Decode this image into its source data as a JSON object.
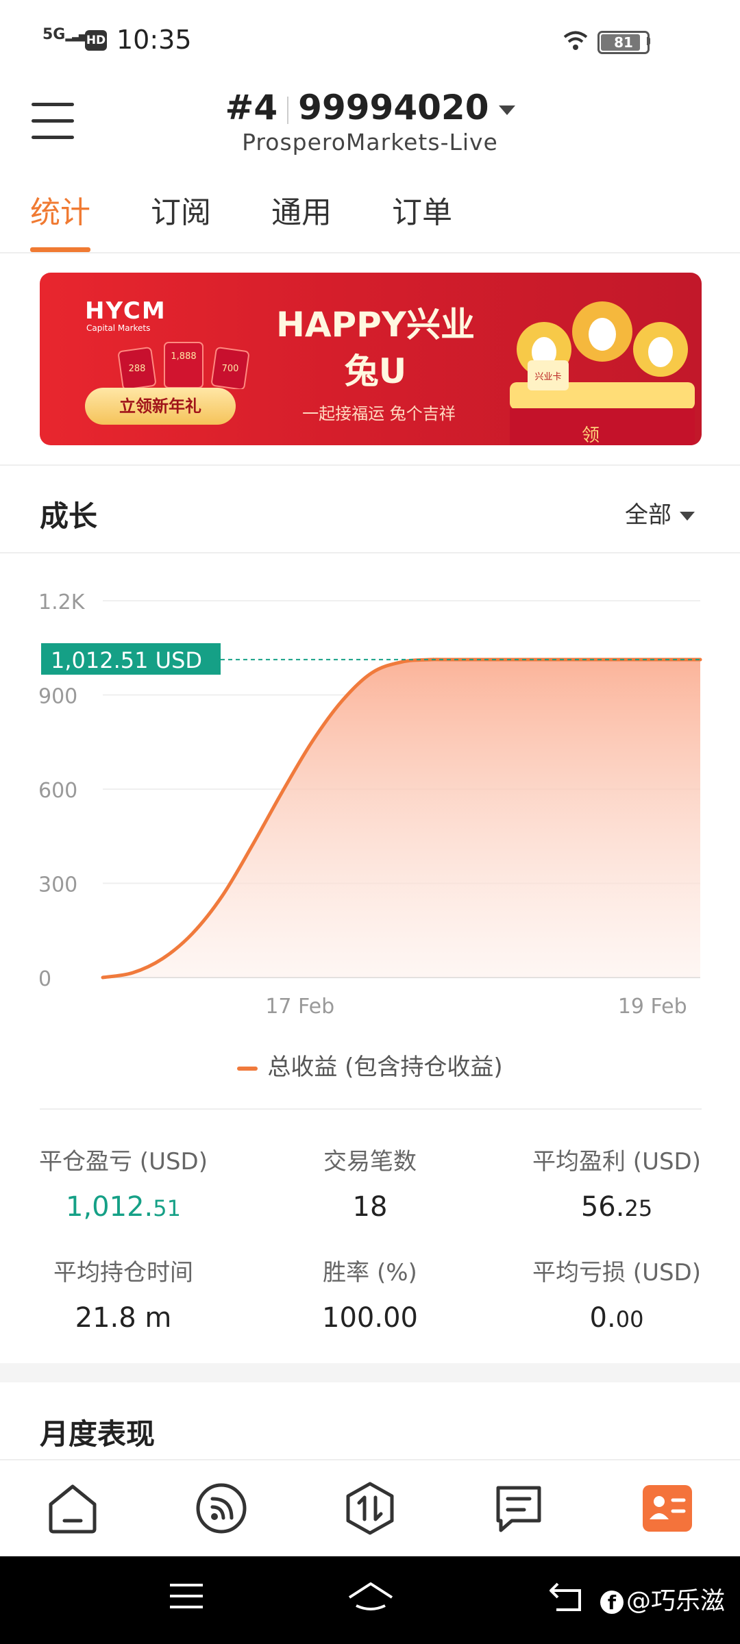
{
  "status_bar": {
    "network": "5G",
    "hd": "HD",
    "time": "10:35",
    "battery": "81"
  },
  "header": {
    "account_number": "#4",
    "account_id": "99994020",
    "server": "ProsperoMarkets-Live"
  },
  "tabs": [
    {
      "label": "统计",
      "active": true
    },
    {
      "label": "订阅",
      "active": false
    },
    {
      "label": "通用",
      "active": false
    },
    {
      "label": "订单",
      "active": false
    }
  ],
  "banner": {
    "logo": "HYCM",
    "logo_sub": "Capital Markets",
    "envelope_values": [
      "288",
      "1,888",
      "700"
    ],
    "button_label": "立领新年礼",
    "title_line1": "HAPPY兴业",
    "title_line2": "兔U",
    "subtitle": "一起接福运 兔个吉祥",
    "card_label": "兴业卡",
    "box_text": "领"
  },
  "growth": {
    "title": "成长",
    "filter_label": "全部"
  },
  "chart_data": {
    "type": "area",
    "y_ticks": [
      "0",
      "300",
      "600",
      "900",
      "1.2K"
    ],
    "ylim": [
      0,
      1200
    ],
    "x_tick_labels": [
      "17 Feb",
      "19 Feb"
    ],
    "current_value_label": "1,012.51  USD",
    "current_value": 1012.51,
    "series": [
      {
        "name": "总收益 (包含持仓收益)",
        "x": [
          0,
          0.05,
          0.1,
          0.15,
          0.2,
          0.25,
          0.3,
          0.35,
          0.4,
          0.45,
          0.5,
          0.55,
          0.6,
          1.0
        ],
        "values": [
          0,
          15,
          60,
          140,
          260,
          420,
          590,
          750,
          880,
          970,
          1005,
          1012.51,
          1012.51,
          1012.51
        ]
      }
    ],
    "colors": {
      "line": "#f07a3c",
      "area_top": "#fbb9a0",
      "label_bg": "#15a086",
      "dash": "#15a086"
    },
    "grid": true
  },
  "legend": {
    "label": "总收益 (包含持仓收益)"
  },
  "stats": [
    {
      "label": "平仓盈亏 (USD)",
      "int": "1,012.",
      "frac": "51",
      "green": true
    },
    {
      "label": "交易笔数",
      "int": "18",
      "frac": "",
      "green": false
    },
    {
      "label": "平均盈利 (USD)",
      "int": "56.",
      "frac": "25",
      "green": false
    },
    {
      "label": "平均持仓时间",
      "int": "21.8 m",
      "frac": "",
      "green": false
    },
    {
      "label": "胜率 (%)",
      "int": "100.00",
      "frac": "",
      "green": false
    },
    {
      "label": "平均亏损 (USD)",
      "int": "0.",
      "frac": "00",
      "green": false
    }
  ],
  "monthly": {
    "title": "月度表现"
  },
  "bottom_nav": [
    "home-icon",
    "feed-icon",
    "trade-icon",
    "message-icon",
    "account-icon"
  ],
  "system_nav": {
    "watermark": "@巧乐滋"
  }
}
